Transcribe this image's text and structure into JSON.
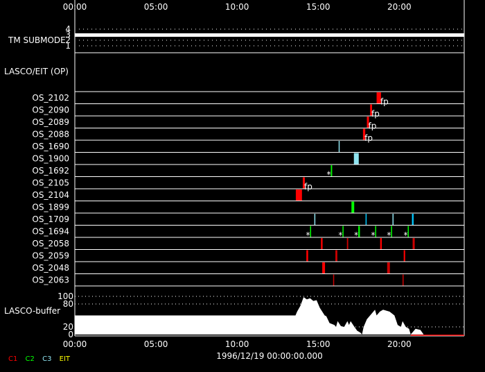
{
  "chart_data": {
    "type": "timeline",
    "date_label": "1996/12/19 00:00:00.000",
    "x_range_hours": [
      0,
      24
    ],
    "x_ticks": [
      "00:00",
      "05:00",
      "10:00",
      "15:00",
      "20:00"
    ],
    "x_tick_hours": [
      0,
      5,
      10,
      15,
      20
    ],
    "tm_submode": {
      "label": "TM SUBMODE",
      "ticks": [
        "4",
        "3",
        "2",
        "1"
      ],
      "value": 3
    },
    "section_label": "LASCO/EIT (OP)",
    "rows": [
      "OS_2102",
      "OS_2090",
      "OS_2089",
      "OS_2088",
      "OS_1690",
      "OS_1900",
      "OS_1692",
      "OS_2105",
      "OS_2104",
      "OS_1899",
      "OS_1709",
      "OS_1694",
      "OS_2058",
      "OS_2059",
      "OS_2048",
      "OS_2063"
    ],
    "events": [
      {
        "row": "OS_2102",
        "start": 18.6,
        "end": 18.87,
        "color": "#ff0000",
        "mark": "fp"
      },
      {
        "row": "OS_2090",
        "start": 18.2,
        "end": 18.32,
        "color": "#ff0000",
        "mark": "fp"
      },
      {
        "row": "OS_2089",
        "start": 18.0,
        "end": 18.13,
        "color": "#ff0000",
        "mark": "fp"
      },
      {
        "row": "OS_2088",
        "start": 17.76,
        "end": 17.9,
        "color": "#ff0000",
        "mark": "fp"
      },
      {
        "row": "OS_1690",
        "start": 16.26,
        "end": 16.32,
        "color": "#8fe3ef"
      },
      {
        "row": "OS_1900",
        "start": 17.2,
        "end": 17.5,
        "color": "#8fe3ef"
      },
      {
        "row": "OS_1692",
        "start": 15.78,
        "end": 15.86,
        "color": "#00ff00",
        "mark": "*"
      },
      {
        "row": "OS_2105",
        "start": 14.05,
        "end": 14.18,
        "color": "#ff0000",
        "mark": "fp"
      },
      {
        "row": "OS_2104",
        "start": 13.62,
        "end": 14.0,
        "color": "#ff0000"
      },
      {
        "row": "OS_1899",
        "start": 17.05,
        "end": 17.22,
        "color": "#00ff00"
      },
      {
        "row": "OS_1709",
        "start": 14.76,
        "end": 14.8,
        "color": "#8fe3ef"
      },
      {
        "row": "OS_1709",
        "start": 17.92,
        "end": 17.96,
        "color": "#00c8ff"
      },
      {
        "row": "OS_1709",
        "start": 19.58,
        "end": 19.62,
        "color": "#8fe3ef"
      },
      {
        "row": "OS_1709",
        "start": 20.78,
        "end": 20.88,
        "color": "#00c8ff"
      },
      {
        "row": "OS_1694",
        "start": 14.5,
        "end": 14.54,
        "color": "#00ff00",
        "mark": "*"
      },
      {
        "row": "OS_1694",
        "start": 16.5,
        "end": 16.54,
        "color": "#00ff00",
        "mark": "*"
      },
      {
        "row": "OS_1694",
        "start": 17.47,
        "end": 17.57,
        "color": "#00ff00",
        "mark": "*"
      },
      {
        "row": "OS_1694",
        "start": 18.51,
        "end": 18.55,
        "color": "#00ff00",
        "mark": "*"
      },
      {
        "row": "OS_1694",
        "start": 19.49,
        "end": 19.53,
        "color": "#00ff00",
        "mark": "*"
      },
      {
        "row": "OS_1694",
        "start": 20.52,
        "end": 20.56,
        "color": "#00ff00",
        "mark": "*"
      },
      {
        "row": "OS_2058",
        "start": 15.17,
        "end": 15.27,
        "color": "#ff0000"
      },
      {
        "row": "OS_2058",
        "start": 16.77,
        "end": 16.85,
        "color": "#cc0000"
      },
      {
        "row": "OS_2058",
        "start": 18.82,
        "end": 18.92,
        "color": "#ff0000"
      },
      {
        "row": "OS_2058",
        "start": 20.82,
        "end": 20.95,
        "color": "#cc0000"
      },
      {
        "row": "OS_2059",
        "start": 14.27,
        "end": 14.38,
        "color": "#ff0000"
      },
      {
        "row": "OS_2059",
        "start": 16.06,
        "end": 16.18,
        "color": "#cc0000"
      },
      {
        "row": "OS_2059",
        "start": 20.27,
        "end": 20.36,
        "color": "#ff0000"
      },
      {
        "row": "OS_2048",
        "start": 15.25,
        "end": 15.42,
        "color": "#ff0000"
      },
      {
        "row": "OS_2048",
        "start": 19.25,
        "end": 19.42,
        "color": "#cc0000"
      },
      {
        "row": "OS_2063",
        "start": 15.92,
        "end": 15.96,
        "color": "#cc0000"
      },
      {
        "row": "OS_2063",
        "start": 20.2,
        "end": 20.24,
        "color": "#cc0000"
      }
    ],
    "buffer": {
      "label": "LASCO-buffer",
      "ylim": [
        0,
        100
      ],
      "y_ticks": [
        "100",
        "80",
        "20",
        "0"
      ],
      "y_tick_values": [
        100,
        80,
        20,
        0
      ],
      "series": [
        [
          0,
          50
        ],
        [
          13.6,
          50
        ],
        [
          13.7,
          60
        ],
        [
          13.9,
          75
        ],
        [
          14.1,
          98
        ],
        [
          14.3,
          92
        ],
        [
          14.5,
          95
        ],
        [
          14.7,
          88
        ],
        [
          14.9,
          90
        ],
        [
          15.1,
          70
        ],
        [
          15.4,
          50
        ],
        [
          15.5,
          48
        ],
        [
          15.7,
          30
        ],
        [
          16.0,
          25
        ],
        [
          16.1,
          20
        ],
        [
          16.2,
          35
        ],
        [
          16.4,
          22
        ],
        [
          16.6,
          20
        ],
        [
          16.8,
          35
        ],
        [
          16.9,
          25
        ],
        [
          17.0,
          35
        ],
        [
          17.2,
          22
        ],
        [
          17.4,
          10
        ],
        [
          17.6,
          5
        ],
        [
          17.7,
          0
        ],
        [
          17.8,
          20
        ],
        [
          18.0,
          40
        ],
        [
          18.3,
          55
        ],
        [
          18.5,
          65
        ],
        [
          18.6,
          50
        ],
        [
          18.8,
          60
        ],
        [
          19.0,
          65
        ],
        [
          19.4,
          60
        ],
        [
          19.7,
          50
        ],
        [
          19.9,
          25
        ],
        [
          20.1,
          20
        ],
        [
          20.2,
          35
        ],
        [
          20.4,
          20
        ],
        [
          20.6,
          15
        ],
        [
          20.7,
          0
        ],
        [
          21.0,
          15
        ],
        [
          21.3,
          12
        ],
        [
          21.5,
          0
        ],
        [
          24,
          0
        ]
      ]
    },
    "legend": [
      {
        "label": "C1",
        "color": "#ff0000"
      },
      {
        "label": "C2",
        "color": "#00ff00"
      },
      {
        "label": "C3",
        "color": "#8fe3ef"
      },
      {
        "label": "EIT",
        "color": "#ffff00"
      }
    ]
  }
}
